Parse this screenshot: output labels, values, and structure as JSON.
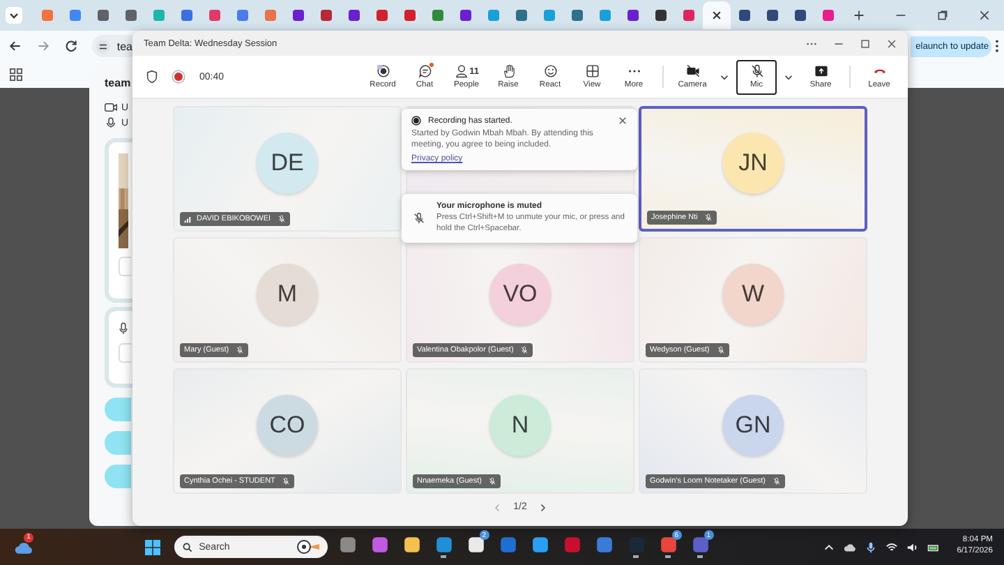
{
  "browser": {
    "tabs": [
      {
        "color": "#f4733c",
        "selected": false
      },
      {
        "color": "#4285f4",
        "selected": false
      },
      {
        "color": "#5f6368",
        "selected": false
      },
      {
        "color": "#5f6368",
        "selected": false
      },
      {
        "color": "#1fb5a8",
        "selected": false
      },
      {
        "color": "#3b6fe0",
        "selected": false
      },
      {
        "color": "#e2396b",
        "selected": false
      },
      {
        "color": "#4a7bea",
        "selected": false
      },
      {
        "color": "#e8734a",
        "selected": false
      },
      {
        "color": "#6a1fd1",
        "selected": false
      },
      {
        "color": "#b8283a",
        "selected": false
      },
      {
        "color": "#6a1fd1",
        "selected": false
      },
      {
        "color": "#d3202f",
        "selected": false
      },
      {
        "color": "#d3202f",
        "selected": false
      },
      {
        "color": "#2f8a3b",
        "selected": false
      },
      {
        "color": "#6a1fd1",
        "selected": false
      },
      {
        "color": "#1aa0d8",
        "selected": false
      },
      {
        "color": "#2e6f8a",
        "selected": false
      },
      {
        "color": "#1aa0d8",
        "selected": false
      },
      {
        "color": "#2e6f8a",
        "selected": false
      },
      {
        "color": "#1aa0d8",
        "selected": false
      },
      {
        "color": "#6a1fd1",
        "selected": false
      },
      {
        "color": "#333333",
        "selected": false
      },
      {
        "color": "#e0245e",
        "selected": false
      },
      {
        "selected": true
      },
      {
        "color": "#2d4a7a",
        "selected": false
      },
      {
        "color": "#2d4a7a",
        "selected": false
      },
      {
        "color": "#2d4a7a",
        "selected": false
      },
      {
        "color": "#e91e8c",
        "selected": false
      }
    ],
    "address": "tea",
    "relaunch": "elaunch to update"
  },
  "prejoin": {
    "title": "team",
    "rows": [
      "U",
      "U"
    ]
  },
  "meeting": {
    "title": "Team Delta: Wednesday Session",
    "timer": "00:40",
    "toolbar": [
      {
        "kind": "record",
        "label": "Record",
        "badge": false,
        "focused": false
      },
      {
        "kind": "chat",
        "label": "Chat",
        "badge": true,
        "focused": false
      },
      {
        "kind": "people",
        "label": "People",
        "count": "11",
        "badge": false,
        "focused": false
      },
      {
        "kind": "raise",
        "label": "Raise",
        "badge": false,
        "focused": false
      },
      {
        "kind": "react",
        "label": "React",
        "badge": false,
        "focused": false
      },
      {
        "kind": "view",
        "label": "View",
        "badge": false,
        "focused": false
      },
      {
        "kind": "more",
        "label": "More",
        "badge": false,
        "focused": false
      },
      {
        "kind": "camera",
        "label": "Camera",
        "badge": false,
        "focused": false
      },
      {
        "kind": "mic",
        "label": "Mic",
        "badge": false,
        "focused": true
      },
      {
        "kind": "share",
        "label": "Share",
        "badge": false,
        "focused": false
      },
      {
        "kind": "leave",
        "label": "Leave",
        "badge": false,
        "focused": false
      }
    ],
    "tiles": [
      {
        "initials": "DE",
        "name": "DAVID EBIKOBOWEI",
        "color": "#d3e9f0",
        "speaking": false,
        "network_icon": true
      },
      {
        "speaking": false
      },
      {
        "initials": "JN",
        "name": "Josephine Nti",
        "color": "#fbe6b0",
        "speaking": true,
        "network_icon": false
      },
      {
        "initials": "M",
        "name": "Mary (Guest)",
        "color": "#e6dcd6",
        "speaking": false,
        "network_icon": false
      },
      {
        "initials": "VO",
        "name": "Valentina Obakpolor (Guest)",
        "color": "#f3d0dc",
        "speaking": false,
        "network_icon": false
      },
      {
        "initials": "W",
        "name": "Wedyson (Guest)",
        "color": "#f3d6cb",
        "speaking": false,
        "network_icon": false
      },
      {
        "initials": "CO",
        "name": "Cynthia Ochei - STUDENT",
        "color": "#ccdbe2",
        "speaking": false,
        "network_icon": false
      },
      {
        "initials": "N",
        "name": "Nnaemeka (Guest)",
        "color": "#ccebd8",
        "speaking": false,
        "network_icon": false
      },
      {
        "initials": "GN",
        "name": "Godwin's Loom Notetaker (Guest)",
        "color": "#c9d6eb",
        "speaking": false,
        "network_icon": false
      }
    ],
    "recording_notice": {
      "title": "Recording has started.",
      "body": "Started by Godwin Mbah Mbah. By attending this meeting, you agree to being included.",
      "link": "Privacy policy"
    },
    "mute_notice": {
      "title": "Your microphone is muted",
      "body": "Press Ctrl+Shift+M to unmute your mic, or press and hold the Ctrl+Spacebar."
    },
    "page": "1/2"
  },
  "taskbar": {
    "weather_badge": "1",
    "search": "Search",
    "apps": [
      {
        "color": "#8a8a8a",
        "running": false
      },
      {
        "color": "#c05ae0",
        "running": false
      },
      {
        "color": "#f2c14e",
        "running": false
      },
      {
        "color": "#1f8fd6",
        "running": true
      },
      {
        "color": "#e9e9e9",
        "badge": "2",
        "running": false
      },
      {
        "color": "#1f6fd1",
        "running": false
      },
      {
        "color": "#2a9df4",
        "running": false
      },
      {
        "color": "#c8102e",
        "running": false
      },
      {
        "color": "#3a7bd5",
        "running": false
      },
      {
        "color": "#1b2838",
        "running": true
      },
      {
        "color": "#e8453c",
        "badge": "6",
        "running": true
      },
      {
        "color": "#5b5fc7",
        "badge": "1",
        "running": true
      }
    ],
    "time": "8:04 PM",
    "date": "6/17/2026"
  }
}
